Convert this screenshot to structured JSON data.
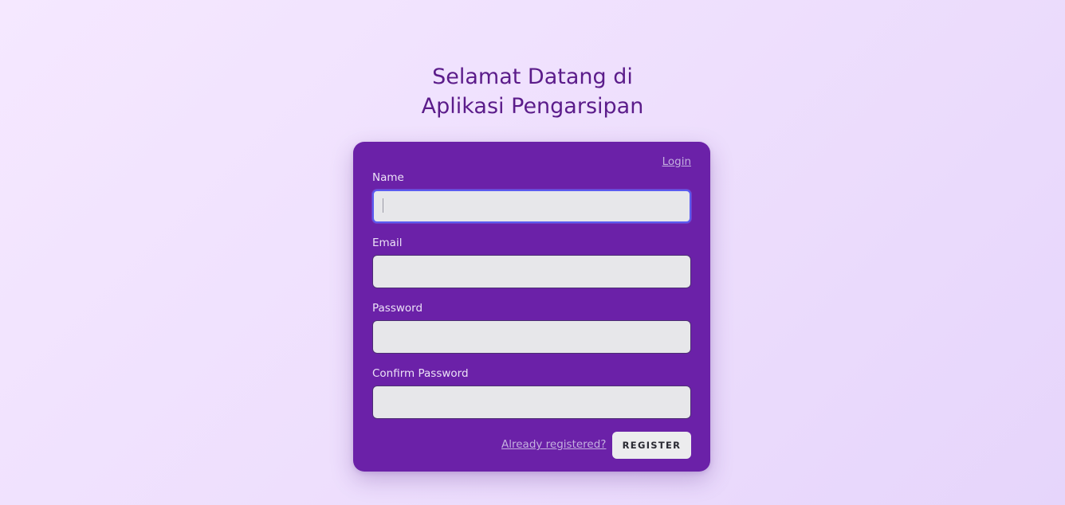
{
  "header": {
    "title_line1": "Selamat Datang di",
    "title_line2": "Aplikasi Pengarsipan"
  },
  "form": {
    "login_link": "Login",
    "fields": [
      {
        "label": "Name",
        "value": "",
        "focused": true
      },
      {
        "label": "Email",
        "value": ""
      },
      {
        "label": "Password",
        "value": ""
      },
      {
        "label": "Confirm Password",
        "value": ""
      }
    ],
    "already_registered_link": "Already registered?",
    "register_button": "REGISTER"
  },
  "colors": {
    "card_background": "#6b21a8",
    "title_color": "#5b1c8a",
    "input_background": "#e7e7ea",
    "focus_border": "#5b5bf0",
    "link_color": "#c4b0df"
  }
}
